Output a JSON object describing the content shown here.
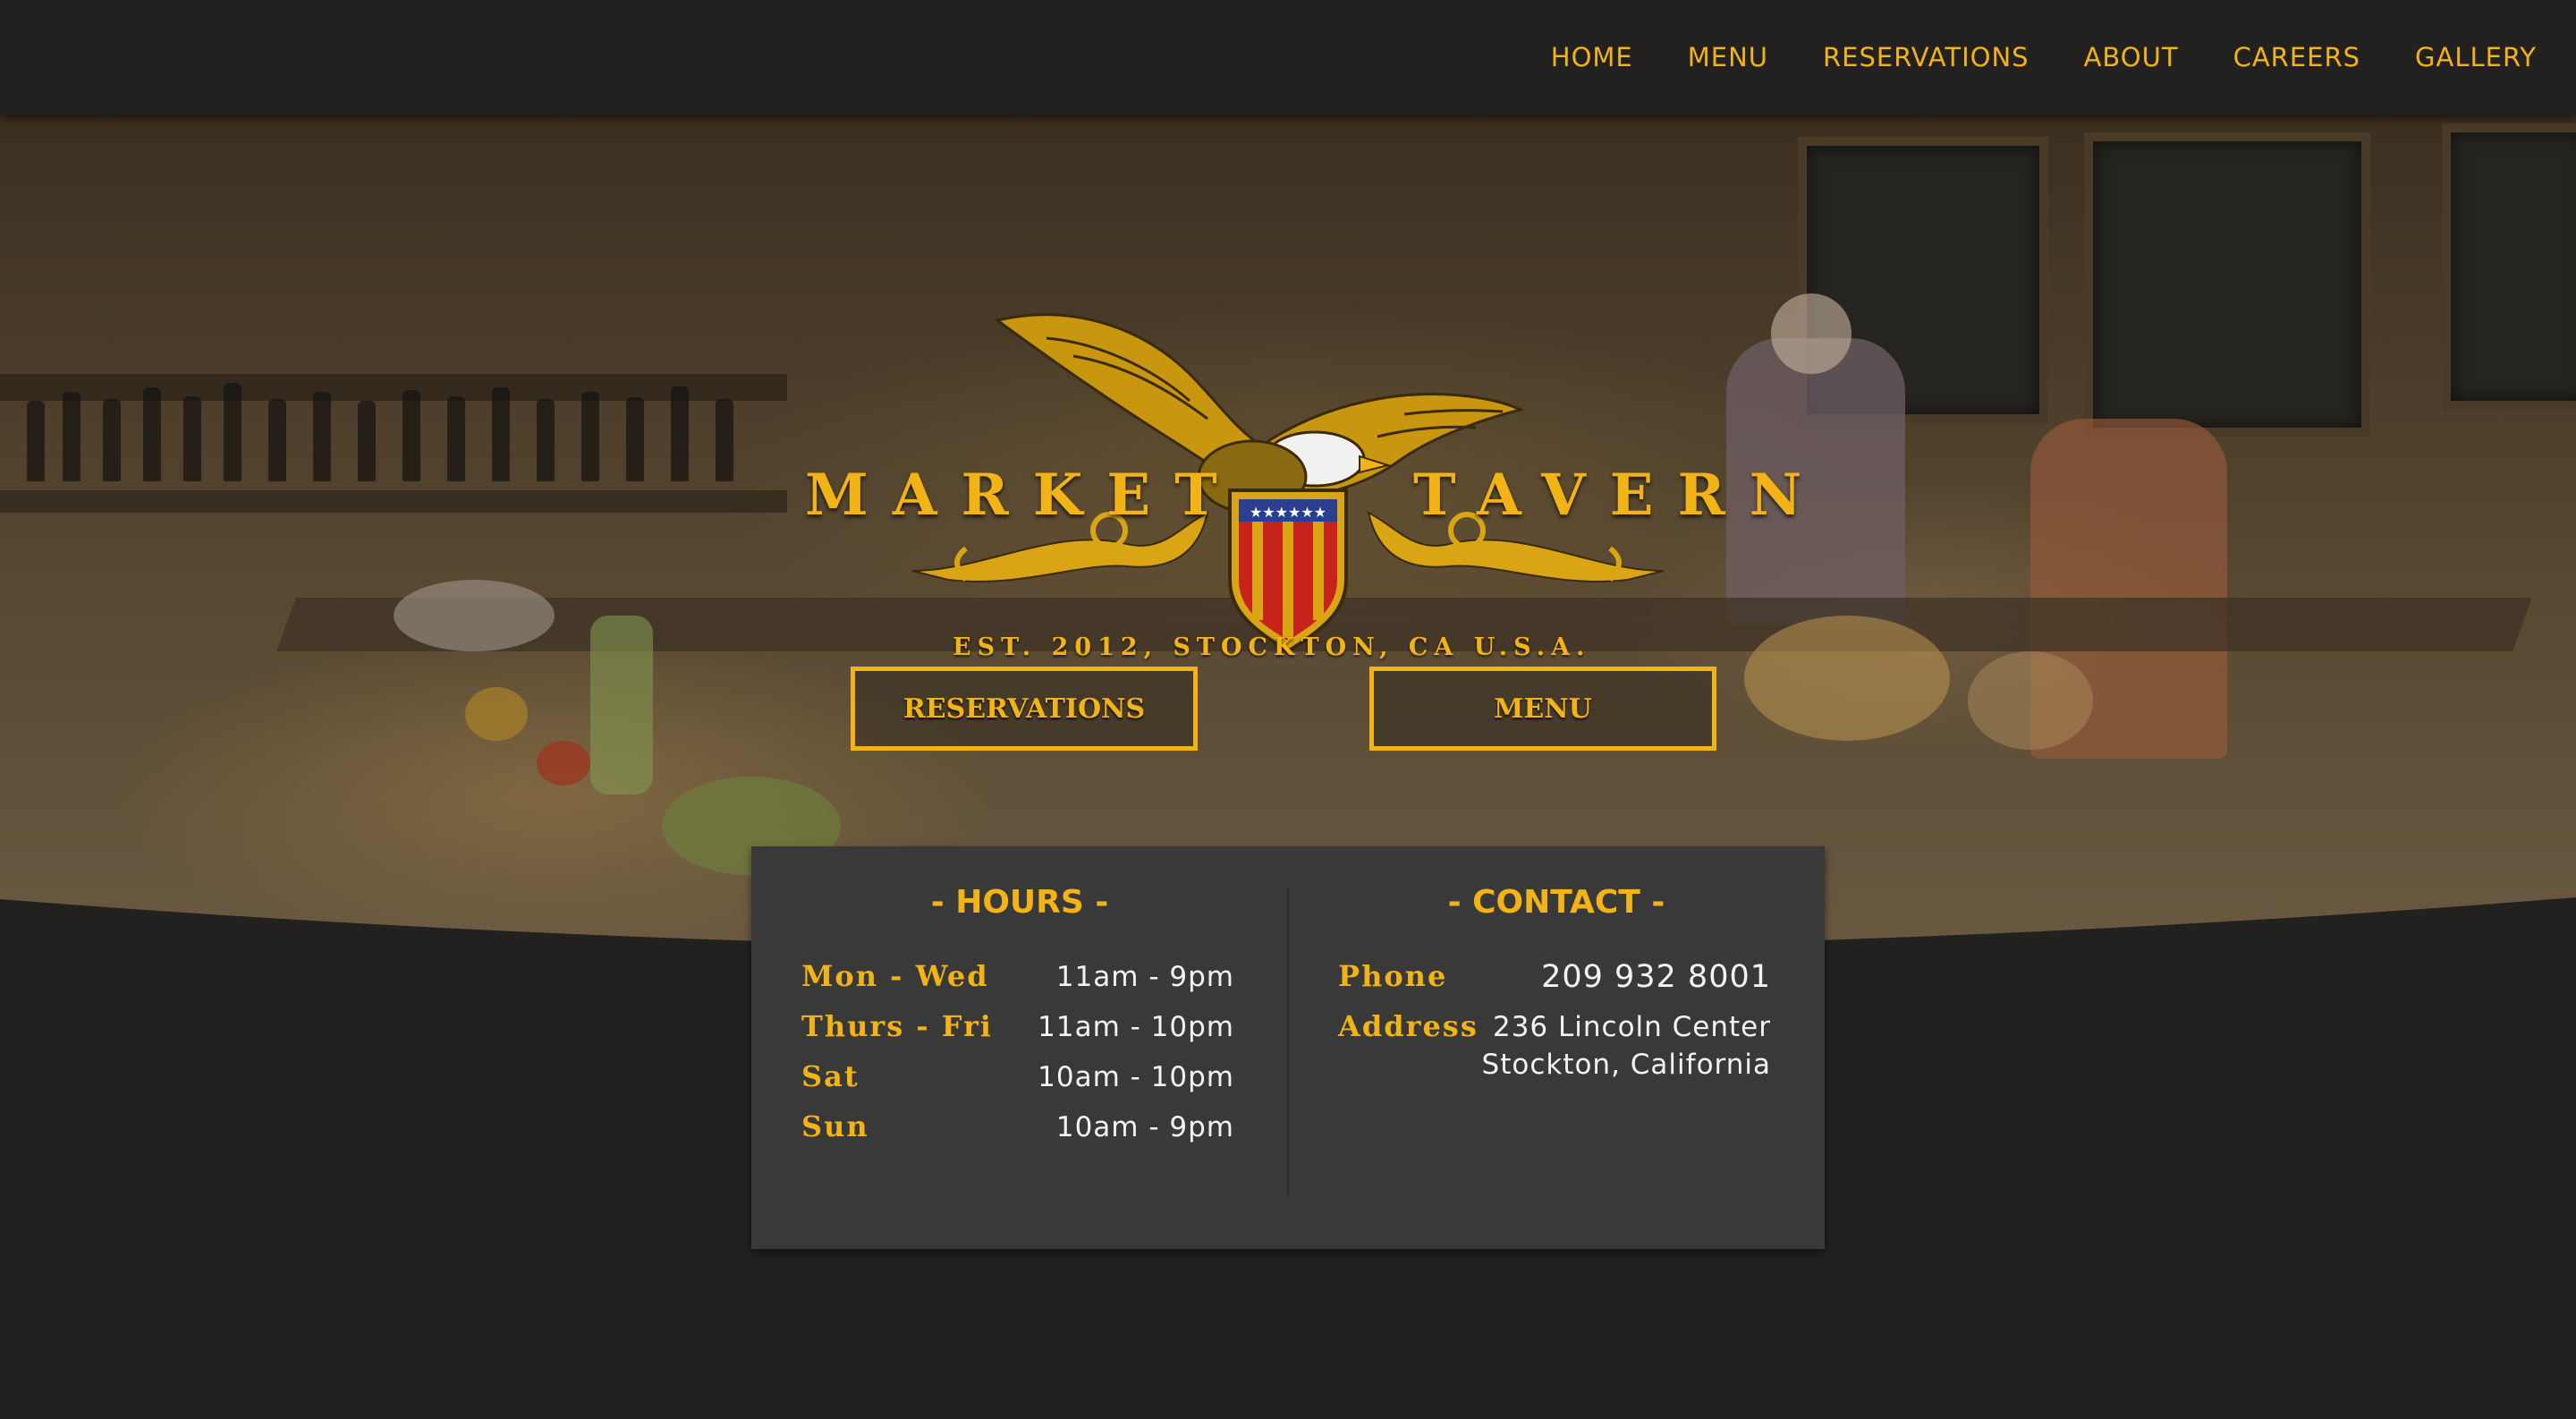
{
  "nav": {
    "items": [
      "HOME",
      "MENU",
      "RESERVATIONS",
      "ABOUT",
      "CAREERS",
      "GALLERY"
    ]
  },
  "hero": {
    "logo_left": "MARKET",
    "logo_right": "TAVERN",
    "tagline": "EST. 2012,  STOCKTON, CA U.S.A.",
    "reservations_button": "RESERVATIONS",
    "menu_button": "MENU"
  },
  "hours": {
    "title": "- HOURS -",
    "rows": [
      {
        "day": "Mon - Wed",
        "time": "11am - 9pm"
      },
      {
        "day": "Thurs - Fri",
        "time": "11am - 10pm"
      },
      {
        "day": "Sat",
        "time": "10am - 10pm"
      },
      {
        "day": "Sun",
        "time": "10am - 9pm"
      }
    ]
  },
  "contact": {
    "title": "- CONTACT -",
    "phone_label": "Phone",
    "phone": "209 932 8001",
    "address_label": "Address",
    "address_line1": "236 Lincoln Center",
    "address_line2": "Stockton, California"
  },
  "colors": {
    "accent": "#f2b316",
    "background": "#222120",
    "panel": "#3a3939"
  }
}
